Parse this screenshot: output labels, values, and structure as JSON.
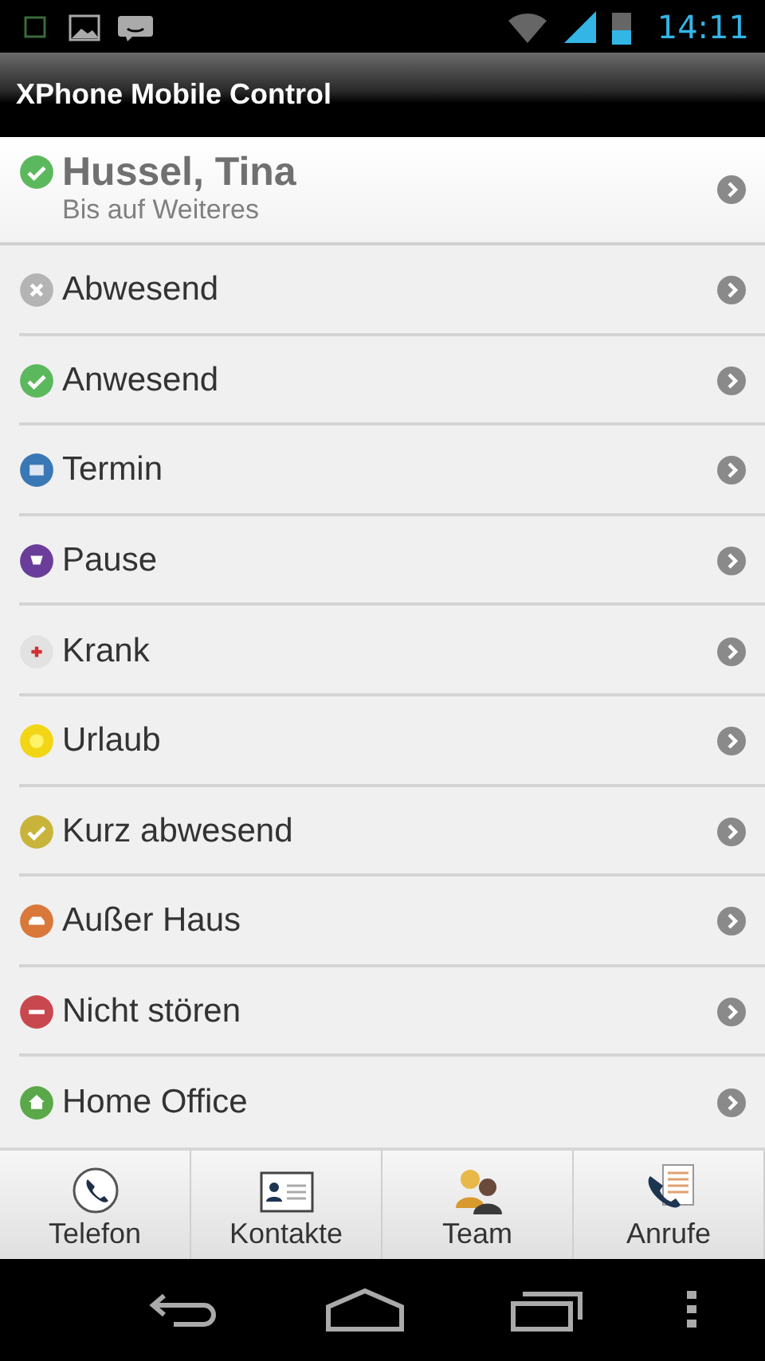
{
  "status_bar": {
    "time": "14:11"
  },
  "app_bar": {
    "title": "XPhone Mobile Control"
  },
  "current_user": {
    "name": "Hussel, Tina",
    "kind": "check",
    "color": "#5cb85c",
    "duration": "Bis auf Weiteres"
  },
  "statuses": [
    {
      "label": "Abwesend",
      "kind": "cross",
      "color": "#b4b4b4"
    },
    {
      "label": "Anwesend",
      "kind": "check",
      "color": "#5cb85c"
    },
    {
      "label": "Termin",
      "kind": "calendar",
      "color": "#3a78b5"
    },
    {
      "label": "Pause",
      "kind": "cup",
      "color": "#6a3d9a"
    },
    {
      "label": "Krank",
      "kind": "plus",
      "color": "#e2e2e2"
    },
    {
      "label": "Urlaub",
      "kind": "sun",
      "color": "#f2d616"
    },
    {
      "label": "Kurz abwesend",
      "kind": "check",
      "color": "#c8b43a"
    },
    {
      "label": "Außer Haus",
      "kind": "car",
      "color": "#d9783a"
    },
    {
      "label": "Nicht stören",
      "kind": "minus",
      "color": "#c9474e"
    },
    {
      "label": "Home Office",
      "kind": "house",
      "color": "#5aa84a"
    }
  ],
  "tabs": [
    {
      "label": "Telefon",
      "kind": "phone"
    },
    {
      "label": "Kontakte",
      "kind": "card"
    },
    {
      "label": "Team",
      "kind": "people"
    },
    {
      "label": "Anrufe",
      "kind": "calls"
    }
  ]
}
